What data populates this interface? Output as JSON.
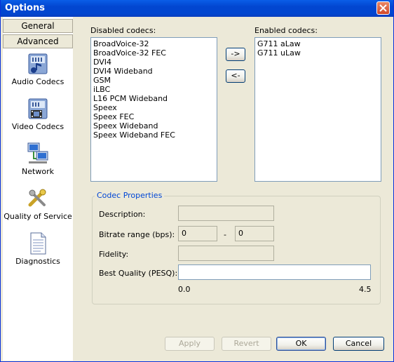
{
  "window": {
    "title": "Options"
  },
  "sidebar": {
    "tabs": [
      {
        "label": "General"
      },
      {
        "label": "Advanced"
      }
    ],
    "items": [
      {
        "label": "Audio Codecs",
        "icon": "audio-codecs-icon"
      },
      {
        "label": "Video Codecs",
        "icon": "video-codecs-icon"
      },
      {
        "label": "Network",
        "icon": "network-icon"
      },
      {
        "label": "Quality of Service",
        "icon": "quality-of-service-icon"
      },
      {
        "label": "Diagnostics",
        "icon": "diagnostics-icon"
      }
    ]
  },
  "codecs": {
    "disabled_label": "Disabled codecs:",
    "enabled_label": "Enabled codecs:",
    "disabled": [
      "BroadVoice-32",
      "BroadVoice-32 FEC",
      "DVI4",
      "DVI4 Wideband",
      "GSM",
      "iLBC",
      "L16 PCM Wideband",
      "Speex",
      "Speex FEC",
      "Speex Wideband",
      "Speex Wideband FEC"
    ],
    "enabled": [
      "G711 aLaw",
      "G711 uLaw"
    ],
    "move_right_label": "->",
    "move_left_label": "<-"
  },
  "properties": {
    "group_title": "Codec Properties",
    "description_label": "Description:",
    "bitrate_label": "Bitrate range (bps):",
    "bitrate_min": "0",
    "bitrate_sep": "-",
    "bitrate_max": "0",
    "fidelity_label": "Fidelity:",
    "quality_label": "Best Quality (PESQ):",
    "scale_min": "0.0",
    "scale_max": "4.5"
  },
  "buttons": {
    "apply": "Apply",
    "revert": "Revert",
    "ok": "OK",
    "cancel": "Cancel"
  }
}
